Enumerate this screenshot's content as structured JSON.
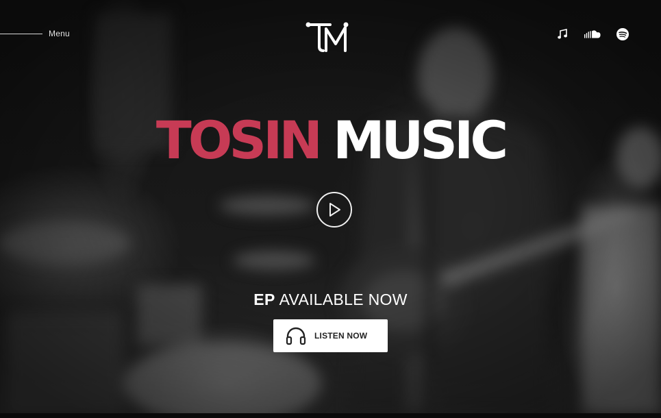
{
  "header": {
    "menu_label": "Menu",
    "logo_text": "TM",
    "social_icons": [
      "apple-music-icon",
      "soundcloud-icon",
      "spotify-icon"
    ]
  },
  "hero": {
    "title_part1": "TOSIN",
    "title_part2": "MUSIC",
    "tagline_bold": "EP",
    "tagline_rest": "AVAILABLE NOW",
    "cta_label": "LISTEN NOW"
  },
  "colors": {
    "accent": "#c73b55",
    "text": "#ffffff",
    "background": "#141414"
  }
}
